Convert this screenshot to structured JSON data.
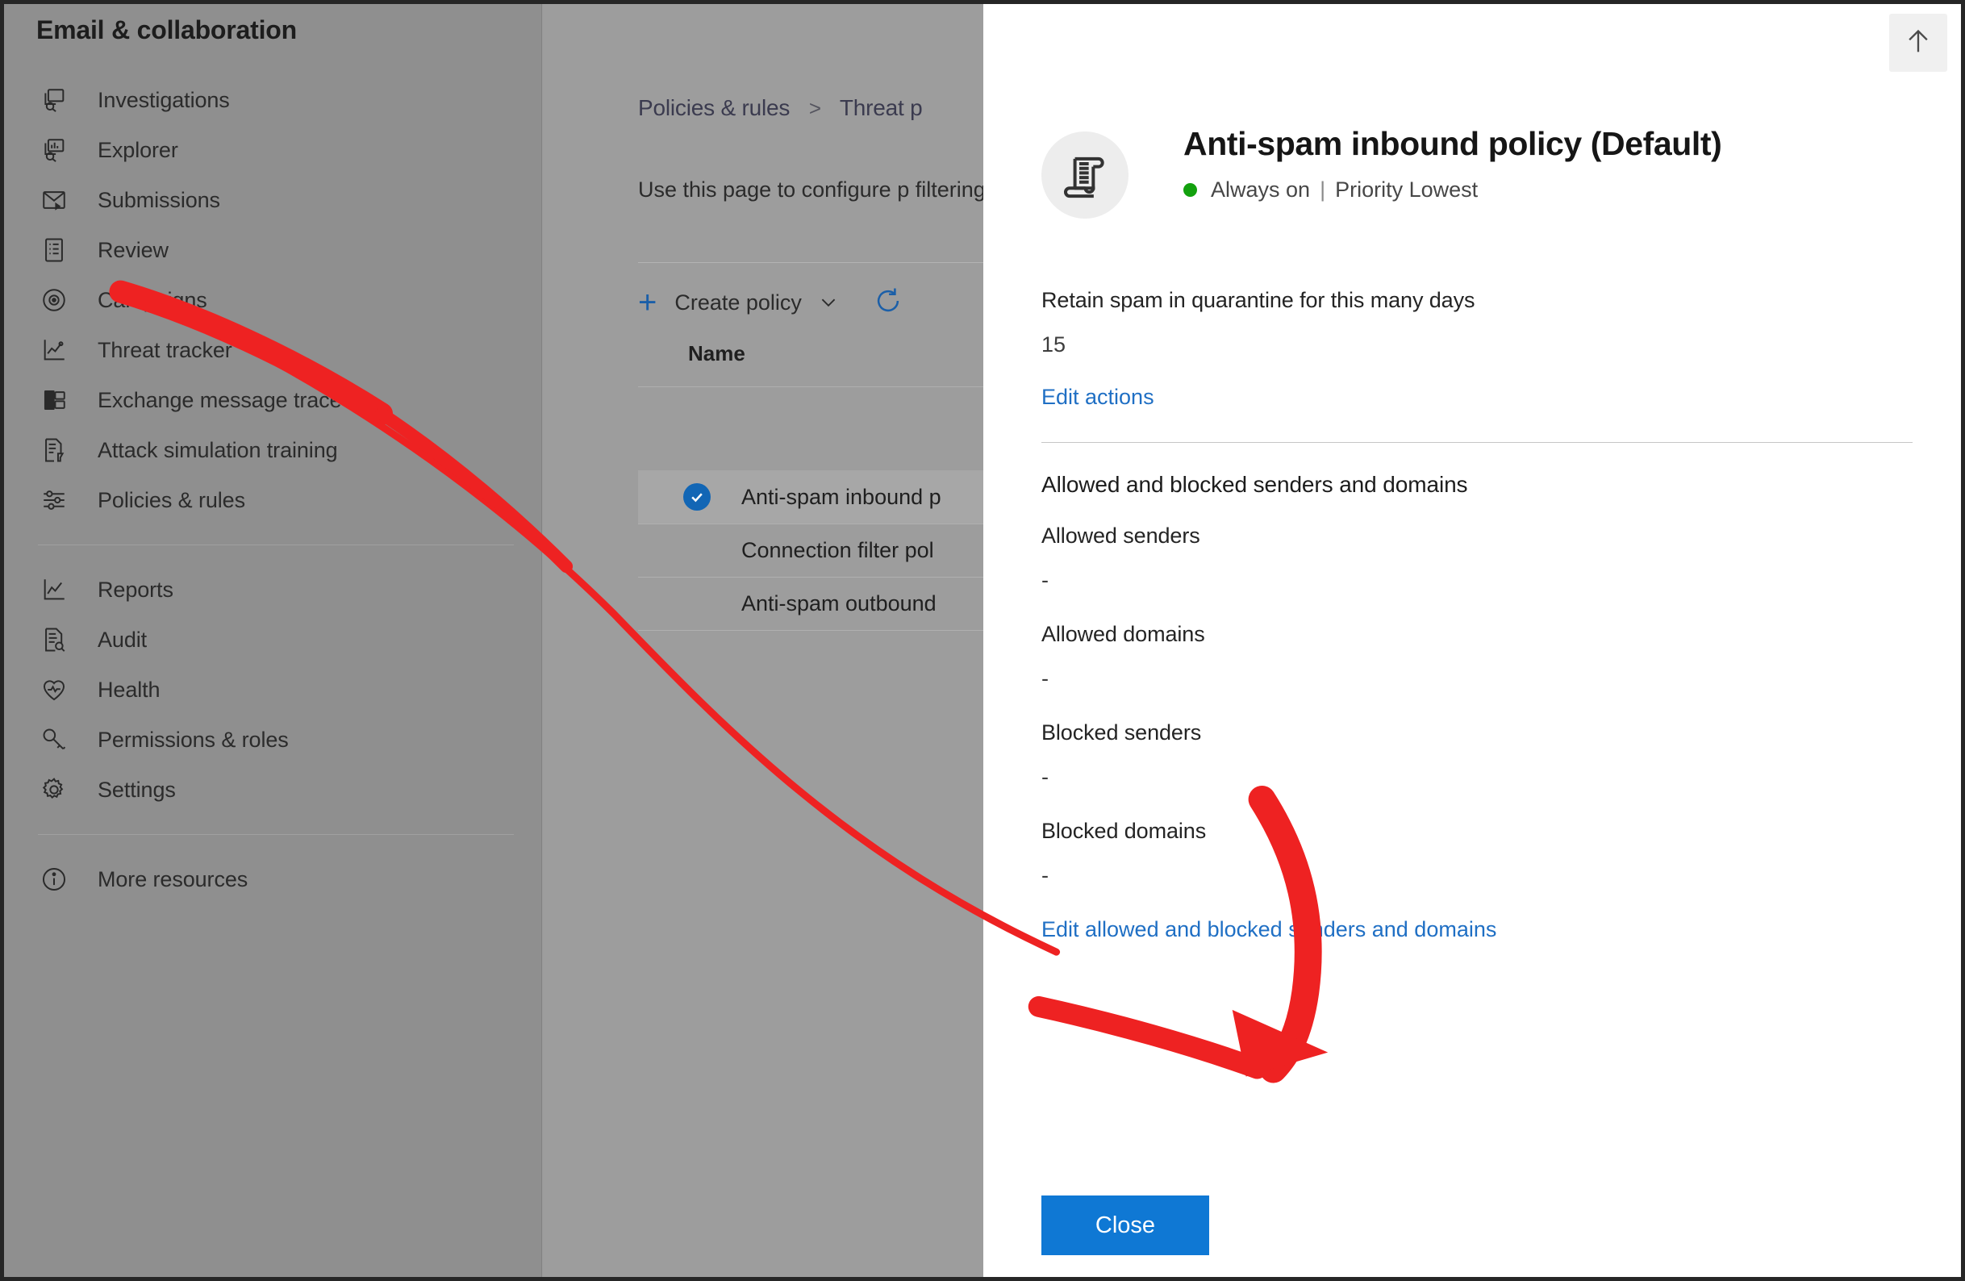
{
  "colors": {
    "accent_blue": "#0f78d4",
    "link_blue": "#1f6fc4",
    "status_green": "#13a10e",
    "annotation_red": "#ee2222",
    "selected_row": "#a7a7a7",
    "panel_background": "#ffffff"
  },
  "sidebar": {
    "title": "Email & collaboration",
    "items": [
      {
        "label": "Investigations",
        "icon": "investigations-icon"
      },
      {
        "label": "Explorer",
        "icon": "explorer-icon"
      },
      {
        "label": "Submissions",
        "icon": "submissions-icon"
      },
      {
        "label": "Review",
        "icon": "review-icon"
      },
      {
        "label": "Campaigns",
        "icon": "campaigns-icon"
      },
      {
        "label": "Threat tracker",
        "icon": "threat-tracker-icon"
      },
      {
        "label": "Exchange message trace",
        "icon": "exchange-message-trace-icon"
      },
      {
        "label": "Attack simulation training",
        "icon": "attack-simulation-training-icon"
      },
      {
        "label": "Policies & rules",
        "icon": "policies-rules-icon"
      }
    ],
    "items_group2": [
      {
        "label": "Reports",
        "icon": "reports-icon"
      },
      {
        "label": "Audit",
        "icon": "audit-icon"
      },
      {
        "label": "Health",
        "icon": "health-icon"
      },
      {
        "label": "Permissions & roles",
        "icon": "permissions-roles-icon"
      },
      {
        "label": "Settings",
        "icon": "settings-gear-icon"
      }
    ],
    "items_group3": [
      {
        "label": "More resources",
        "icon": "info-icon"
      }
    ]
  },
  "main": {
    "breadcrumb": {
      "root": "Policies & rules",
      "separator": ">",
      "current": "Threat p"
    },
    "description": "Use this page to configure p filtering, spam filtering, and",
    "toolbar": {
      "create_policy_label": "Create policy",
      "plus_glyph": "+",
      "chevron_icon": "chevron-down-icon",
      "refresh_icon": "refresh-icon"
    },
    "list": {
      "column_name": "Name",
      "rows": [
        {
          "name": "Anti-spam inbound p",
          "selected": true
        },
        {
          "name": "Connection filter pol",
          "selected": false
        },
        {
          "name": "Anti-spam outbound",
          "selected": false
        }
      ]
    },
    "scroll_left_icon": "chevron-left-icon"
  },
  "flyout": {
    "scroll_to_top_icon": "arrow-up-icon",
    "avatar_icon": "policy-scroll-icon",
    "title": "Anti-spam inbound policy (Default)",
    "status_text": "Always on",
    "status_separator": "|",
    "priority_text": "Priority Lowest",
    "retention": {
      "label": "Retain spam in quarantine for this many days",
      "value": "15"
    },
    "edit_actions_link": "Edit actions",
    "senders_section": {
      "heading": "Allowed and blocked senders and domains",
      "fields": [
        {
          "label": "Allowed senders",
          "value": "-"
        },
        {
          "label": "Allowed domains",
          "value": "-"
        },
        {
          "label": "Blocked senders",
          "value": "-"
        },
        {
          "label": "Blocked domains",
          "value": "-"
        }
      ],
      "edit_link": "Edit allowed and blocked senders and domains"
    },
    "close_button_label": "Close"
  }
}
